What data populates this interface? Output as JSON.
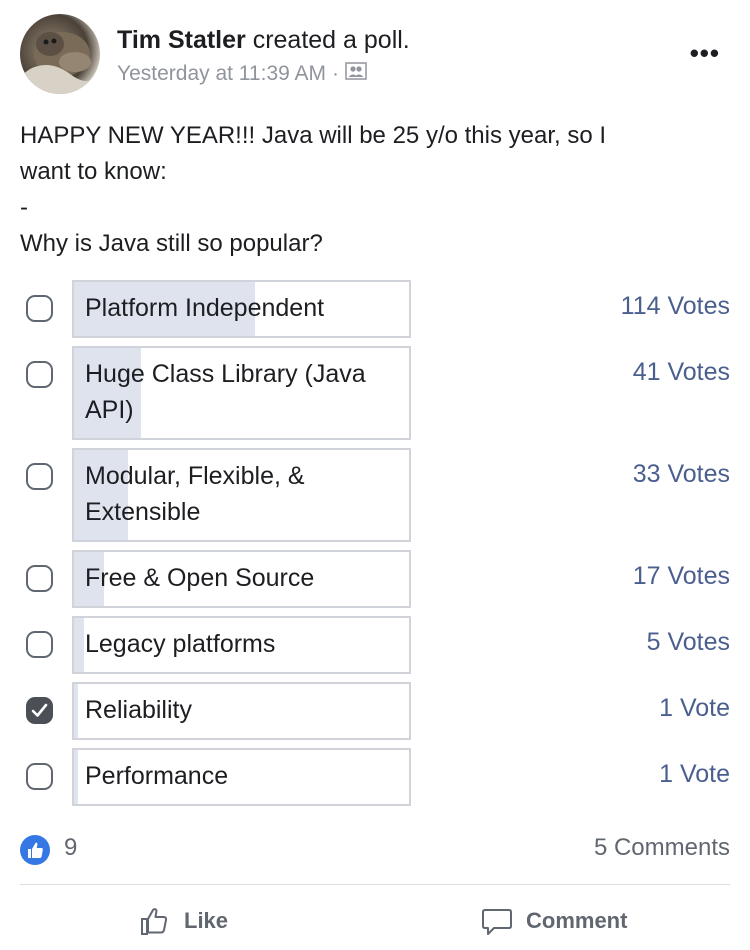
{
  "post": {
    "author": "Tim Statler",
    "action": "created a poll.",
    "timestamp": "Yesterday at 11:39 AM",
    "separator": "·",
    "audience_icon": "friends-icon",
    "more_icon": "more-dots-icon",
    "more_label": "•••",
    "text_lines": [
      "HAPPY NEW YEAR!!! Java will be 25 y/o this year, so I",
      "want to know:",
      "-",
      "Why is Java still so popular?"
    ]
  },
  "poll": {
    "options": [
      {
        "label": "Platform Independent",
        "votes": "114 Votes",
        "fill_fraction": 0.54,
        "checked": false
      },
      {
        "label": "Huge Class Library (Java API)",
        "votes": "41 Votes",
        "fill_fraction": 0.2,
        "checked": false
      },
      {
        "label": "Modular, Flexible, & Extensible",
        "votes": "33 Votes",
        "fill_fraction": 0.16,
        "checked": false
      },
      {
        "label": "Free & Open Source",
        "votes": "17 Votes",
        "fill_fraction": 0.09,
        "checked": false
      },
      {
        "label": "Legacy platforms",
        "votes": "5 Votes",
        "fill_fraction": 0.03,
        "checked": false
      },
      {
        "label": "Reliability",
        "votes": "1 Vote",
        "fill_fraction": 0.01,
        "checked": true
      },
      {
        "label": "Performance",
        "votes": "1 Vote",
        "fill_fraction": 0.01,
        "checked": false
      }
    ]
  },
  "reactions": {
    "like_count": "9",
    "comments": "5 Comments"
  },
  "actions": {
    "like": "Like",
    "comment": "Comment"
  },
  "colors": {
    "fill": "#dfe3ee",
    "votes": "#4b5f8f",
    "like_blue": "#3578e5"
  }
}
